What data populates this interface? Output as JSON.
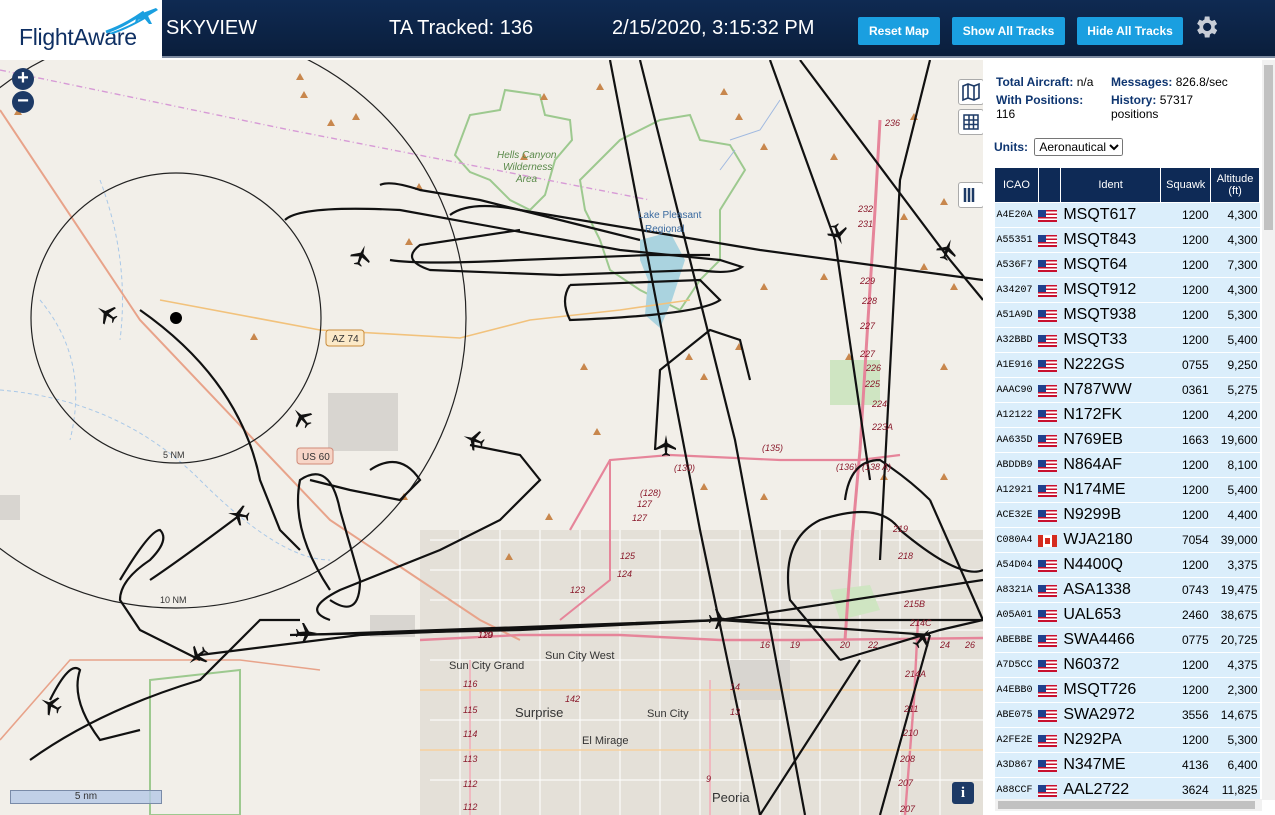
{
  "header": {
    "brand": "FlightAware",
    "site_name": "SKYVIEW",
    "tracked": "TA Tracked: 136",
    "datetime": "2/15/2020, 3:15:32 PM",
    "buttons": {
      "reset_map": "Reset Map",
      "show_all": "Show All Tracks",
      "hide_all": "Hide All Tracks"
    },
    "settings_icon": "gear-icon"
  },
  "map": {
    "labels": {
      "hells_canyon": "Hells Canyon",
      "wilderness": "Wilderness",
      "area": "Area",
      "lake_pleasant": "Lake Pleasant",
      "regional": "Regional",
      "az74": "AZ 74",
      "us60": "US 60",
      "ring_5nm": "5 NM",
      "ring_10nm": "10 NM",
      "sun_city_grand": "Sun City Grand",
      "sun_city_west": "Sun City West",
      "surprise": "Surprise",
      "sun_city": "Sun City",
      "el_mirage": "El Mirage",
      "peoria": "Peoria"
    },
    "scale_label": "5 nm",
    "info_label": "i",
    "zoom_in": "+",
    "zoom_out": "−"
  },
  "stats": {
    "total_aircraft_label": "Total Aircraft:",
    "total_aircraft_value": "n/a",
    "messages_label": "Messages:",
    "messages_value": "826.8/sec",
    "positions_label": "With Positions:",
    "positions_value": "116",
    "history_label": "History:",
    "history_value": "57317",
    "history_unit": "positions"
  },
  "units": {
    "label": "Units:",
    "selected": "Aeronautical"
  },
  "table": {
    "headers": {
      "icao": "ICAO",
      "flag": "",
      "ident": "Ident",
      "squawk": "Squawk",
      "altitude": "Altitude (ft)"
    },
    "rows": [
      {
        "icao": "A4E20A",
        "country": "us",
        "ident": "MSQT617",
        "squawk": "1200",
        "altitude": "4,300"
      },
      {
        "icao": "A55351",
        "country": "us",
        "ident": "MSQT843",
        "squawk": "1200",
        "altitude": "4,300"
      },
      {
        "icao": "A536F7",
        "country": "us",
        "ident": "MSQT64",
        "squawk": "1200",
        "altitude": "7,300"
      },
      {
        "icao": "A34207",
        "country": "us",
        "ident": "MSQT912",
        "squawk": "1200",
        "altitude": "4,300"
      },
      {
        "icao": "A51A9D",
        "country": "us",
        "ident": "MSQT938",
        "squawk": "1200",
        "altitude": "5,300"
      },
      {
        "icao": "A32BBD",
        "country": "us",
        "ident": "MSQT33",
        "squawk": "1200",
        "altitude": "5,400"
      },
      {
        "icao": "A1E916",
        "country": "us",
        "ident": "N222GS",
        "squawk": "0755",
        "altitude": "9,250"
      },
      {
        "icao": "AAAC90",
        "country": "us",
        "ident": "N787WW",
        "squawk": "0361",
        "altitude": "5,275"
      },
      {
        "icao": "A12122",
        "country": "us",
        "ident": "N172FK",
        "squawk": "1200",
        "altitude": "4,200"
      },
      {
        "icao": "AA635D",
        "country": "us",
        "ident": "N769EB",
        "squawk": "1663",
        "altitude": "19,600"
      },
      {
        "icao": "ABDDB9",
        "country": "us",
        "ident": "N864AF",
        "squawk": "1200",
        "altitude": "8,100"
      },
      {
        "icao": "A12921",
        "country": "us",
        "ident": "N174ME",
        "squawk": "1200",
        "altitude": "5,400"
      },
      {
        "icao": "ACE32E",
        "country": "us",
        "ident": "N9299B",
        "squawk": "1200",
        "altitude": "4,400"
      },
      {
        "icao": "C080A4",
        "country": "ca",
        "ident": "WJA2180",
        "squawk": "7054",
        "altitude": "39,000"
      },
      {
        "icao": "A54D04",
        "country": "us",
        "ident": "N4400Q",
        "squawk": "1200",
        "altitude": "3,375"
      },
      {
        "icao": "A8321A",
        "country": "us",
        "ident": "ASA1338",
        "squawk": "0743",
        "altitude": "19,475"
      },
      {
        "icao": "A05A01",
        "country": "us",
        "ident": "UAL653",
        "squawk": "2460",
        "altitude": "38,675"
      },
      {
        "icao": "ABEBBE",
        "country": "us",
        "ident": "SWA4466",
        "squawk": "0775",
        "altitude": "20,725"
      },
      {
        "icao": "A7D5CC",
        "country": "us",
        "ident": "N60372",
        "squawk": "1200",
        "altitude": "4,375"
      },
      {
        "icao": "A4EBB0",
        "country": "us",
        "ident": "MSQT726",
        "squawk": "1200",
        "altitude": "2,300"
      },
      {
        "icao": "ABE075",
        "country": "us",
        "ident": "SWA2972",
        "squawk": "3556",
        "altitude": "14,675"
      },
      {
        "icao": "A2FE2E",
        "country": "us",
        "ident": "N292PA",
        "squawk": "1200",
        "altitude": "5,300"
      },
      {
        "icao": "A3D867",
        "country": "us",
        "ident": "N347ME",
        "squawk": "4136",
        "altitude": "6,400"
      },
      {
        "icao": "A88CCF",
        "country": "us",
        "ident": "AAL2722",
        "squawk": "3624",
        "altitude": "11,825"
      }
    ]
  }
}
